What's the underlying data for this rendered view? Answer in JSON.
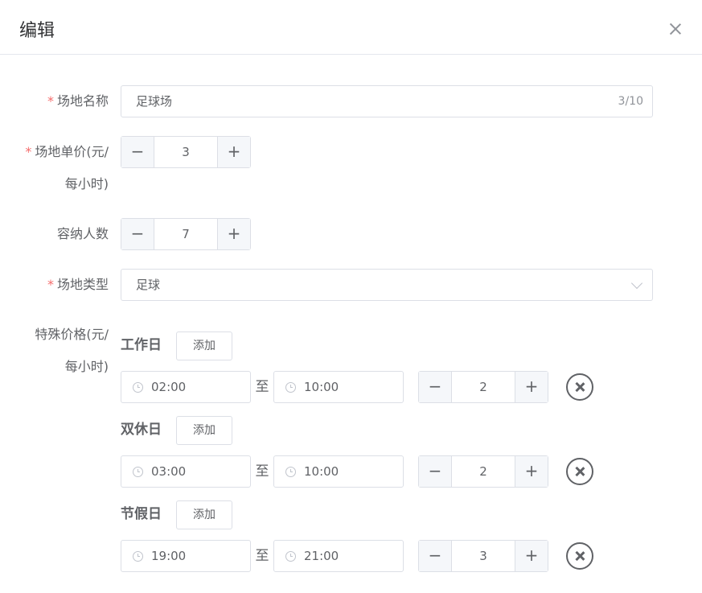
{
  "dialog": {
    "title": "编辑"
  },
  "form": {
    "name": {
      "label": "场地名称",
      "value": "足球场",
      "count": "3/10"
    },
    "price": {
      "label_line1": "场地单价(元/",
      "label_line2": "每小时)",
      "value": "3",
      "dec": "−",
      "inc": "+"
    },
    "capacity": {
      "label": "容纳人数",
      "value": "7",
      "dec": "−",
      "inc": "+"
    },
    "type": {
      "label": "场地类型",
      "value": "足球"
    },
    "special": {
      "label_line1": "特殊价格(元/",
      "label_line2": "每小时)",
      "to_label": "至",
      "add_label": "添加",
      "groups": [
        {
          "title": "工作日",
          "start": "02:00",
          "end": "10:00",
          "price": "2"
        },
        {
          "title": "双休日",
          "start": "03:00",
          "end": "10:00",
          "price": "2"
        },
        {
          "title": "节假日",
          "start": "19:00",
          "end": "21:00",
          "price": "3"
        }
      ]
    }
  },
  "required_mark": "*"
}
